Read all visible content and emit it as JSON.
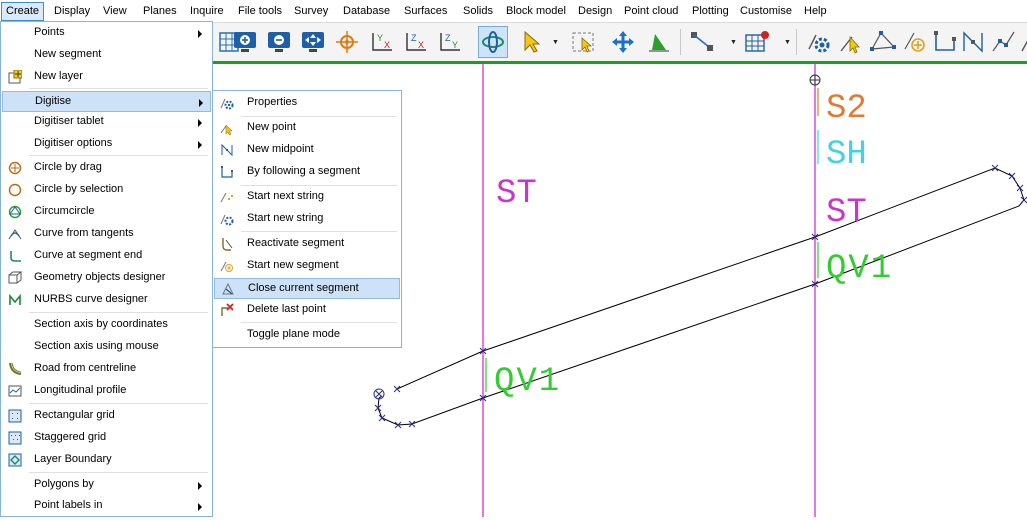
{
  "menubar": {
    "items": [
      "Create",
      "Display",
      "View",
      "Planes",
      "Inquire",
      "File tools",
      "Survey",
      "Database",
      "Surfaces",
      "Solids",
      "Block model",
      "Design",
      "Point cloud",
      "Plotting",
      "Customise",
      "Help"
    ]
  },
  "create_menu": {
    "items": [
      {
        "label": "Points",
        "icon": "",
        "submenu": true
      },
      {
        "label": "New segment",
        "icon": ""
      },
      {
        "label": "New layer",
        "icon": "new-layer-icon"
      },
      {
        "label": "Digitise",
        "icon": "",
        "submenu": true,
        "highlighted": true
      },
      {
        "label": "Digitiser tablet",
        "icon": "",
        "submenu": true
      },
      {
        "label": "Digitiser options",
        "icon": "",
        "submenu": true
      },
      {
        "label": "Circle by drag",
        "icon": "circle-drag-icon"
      },
      {
        "label": "Circle by selection",
        "icon": "circle-selection-icon"
      },
      {
        "label": "Circumcircle",
        "icon": "circumcircle-icon"
      },
      {
        "label": "Curve from tangents",
        "icon": "curve-tangents-icon"
      },
      {
        "label": "Curve at segment end",
        "icon": "curve-segment-end-icon"
      },
      {
        "label": "Geometry objects designer",
        "icon": "geometry-designer-icon"
      },
      {
        "label": "NURBS curve designer",
        "icon": "nurbs-icon"
      },
      {
        "label": "Section axis by coordinates",
        "icon": ""
      },
      {
        "label": "Section axis using mouse",
        "icon": ""
      },
      {
        "label": "Road from centreline",
        "icon": "road-icon"
      },
      {
        "label": "Longitudinal profile",
        "icon": "longitudinal-profile-icon"
      },
      {
        "label": "Rectangular grid",
        "icon": "rectangular-grid-icon"
      },
      {
        "label": "Staggered grid",
        "icon": "staggered-grid-icon"
      },
      {
        "label": "Layer Boundary",
        "icon": "layer-boundary-icon"
      },
      {
        "label": "Polygons by",
        "icon": "",
        "submenu": true
      },
      {
        "label": "Point labels in",
        "icon": "",
        "submenu": true
      }
    ]
  },
  "digitise_menu": {
    "items": [
      {
        "label": "Properties",
        "icon": "properties-gear-icon"
      },
      {
        "label": "New point",
        "icon": "new-point-icon"
      },
      {
        "label": "New midpoint",
        "icon": "new-midpoint-icon"
      },
      {
        "label": "By following a segment",
        "icon": "follow-segment-icon"
      },
      {
        "label": "Start next string",
        "icon": "start-next-string-icon"
      },
      {
        "label": "Start new string",
        "icon": "start-new-string-icon"
      },
      {
        "label": "Reactivate segment",
        "icon": "reactivate-segment-icon"
      },
      {
        "label": "Start new segment",
        "icon": "start-new-segment-icon"
      },
      {
        "label": "Close current segment",
        "icon": "close-segment-icon",
        "highlighted": true
      },
      {
        "label": "Delete last point",
        "icon": "delete-point-icon"
      },
      {
        "label": "Toggle plane mode",
        "icon": ""
      }
    ]
  },
  "viewport": {
    "labels": {
      "left_st": "ST",
      "s2": "S2",
      "sh": "SH",
      "right_st": "ST",
      "qv1_right": "QV1",
      "qv1_left": "QV1"
    },
    "colors": {
      "section_line": "#cc22cc",
      "segment": "#000000",
      "marker": "#2a2a8a",
      "st_label": "#cc33cc",
      "s2_label": "#e07a30",
      "sh_label": "#3fd4e0",
      "qv1_label": "#33cc33",
      "toolbar_accent": "#1ca01c"
    }
  }
}
